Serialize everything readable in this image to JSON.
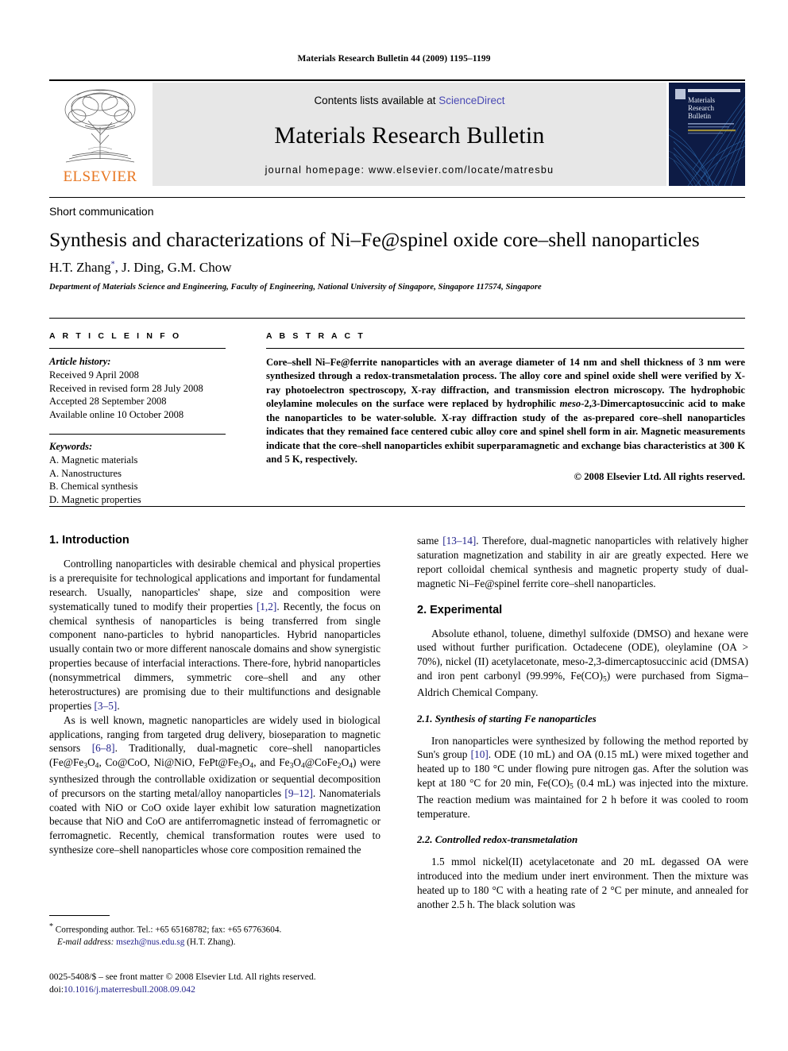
{
  "running_head": "Materials Research Bulletin 44 (2009) 1195–1199",
  "masthead": {
    "publisher": "ELSEVIER",
    "contents_prefix": "Contents lists available at ",
    "sciencedirect": "ScienceDirect",
    "journal_name": "Materials Research Bulletin",
    "homepage": "journal homepage: www.elsevier.com/locate/matresbu",
    "cover_title_line1": "Materials",
    "cover_title_line2": "Research",
    "cover_title_line3": "Bulletin"
  },
  "article": {
    "type": "Short communication",
    "title": "Synthesis and characterizations of Ni–Fe@spinel oxide core–shell nanoparticles",
    "authors": "H.T. Zhang *, J. Ding, G.M. Chow",
    "affiliation": "Department of Materials Science and Engineering, Faculty of Engineering, National University of Singapore, Singapore 117574, Singapore"
  },
  "info": {
    "caption": "A R T I C L E  I N F O",
    "history_label": "Article history:",
    "history": [
      "Received 9 April 2008",
      "Received in revised form 28 July 2008",
      "Accepted 28 September 2008",
      "Available online 10 October 2008"
    ],
    "keywords_label": "Keywords:",
    "keywords": [
      "A. Magnetic materials",
      "A. Nanostructures",
      "B. Chemical synthesis",
      "D. Magnetic properties"
    ]
  },
  "abstract": {
    "caption": "A B S T R A C T",
    "text": "Core–shell Ni–Fe@ferrite nanoparticles with an average diameter of 14 nm and shell thickness of 3 nm were synthesized through a redox-transmetalation process. The alloy core and spinel oxide shell were verified by X-ray photoelectron spectroscopy, X-ray diffraction, and transmission electron microscopy. The hydrophobic oleylamine molecules on the surface were replaced by hydrophilic meso-2,3-Dimercaptosuccinic acid to make the nanoparticles to be water-soluble. X-ray diffraction study of the as-prepared core–shell nanoparticles indicates that they remained face centered cubic alloy core and spinel shell form in air. Magnetic measurements indicate that the core–shell nanoparticles exhibit superparamagnetic and exchange bias characteristics at 300 K and 5 K, respectively.",
    "copyright": "© 2008 Elsevier Ltd. All rights reserved."
  },
  "sections": {
    "introduction_heading": "1. Introduction",
    "intro_p1": "Controlling nanoparticles with desirable chemical and physical properties is a prerequisite for technological applications and important for fundamental research. Usually, nanoparticles' shape, size and composition were systematically tuned to modify their properties [1,2]. Recently, the focus on chemical synthesis of nanoparticles is being transferred from single component nano-particles to hybrid nanoparticles. Hybrid nanoparticles usually contain two or more different nanoscale domains and show synergistic properties because of interfacial interactions. There-fore, hybrid nanoparticles (nonsymmetrical dimmers, symmetric core–shell and any other heterostructures) are promising due to their multifunctions and designable properties [3–5].",
    "intro_p2": "As is well known, magnetic nanoparticles are widely used in biological applications, ranging from targeted drug delivery, bioseparation to magnetic sensors [6–8]. Traditionally, dual-magnetic core–shell nanoparticles (Fe@Fe3O4, Co@CoO, Ni@NiO, FePt@Fe3O4, and Fe3O4@CoFe2O4) were synthesized through the controllable oxidization or sequential decomposition of precursors on the starting metal/alloy nanoparticles [9–12]. Nanomaterials coated with NiO or CoO oxide layer exhibit low saturation magnetization because that NiO and CoO are antiferromagnetic instead of ferromagnetic or ferromagnetic. Recently, chemical transformation routes were used to synthesize core–shell nanoparticles whose core composition remained the",
    "intro_p3": "same [13–14]. Therefore, dual-magnetic nanoparticles with relatively higher saturation magnetization and stability in air are greatly expected. Here we report colloidal chemical synthesis and magnetic property study of dual-magnetic Ni–Fe@spinel ferrite core–shell nanoparticles.",
    "experimental_heading": "2. Experimental",
    "exp_p1": "Absolute ethanol, toluene, dimethyl sulfoxide (DMSO) and hexane were used without further purification. Octadecene (ODE), oleylamine (OA > 70%), nickel (II) acetylacetonate, meso-2,3-dimercaptosuccinic acid (DMSA) and iron pent carbonyl (99.99%, Fe(CO)5) were purchased from Sigma–Aldrich Chemical Company.",
    "sub21_heading": "2.1. Synthesis of starting Fe nanoparticles",
    "sub21_p1": "Iron nanoparticles were synthesized by following the method reported by Sun's group [10]. ODE (10 mL) and OA (0.15 mL) were mixed together and heated up to 180 °C under flowing pure nitrogen gas. After the solution was kept at 180 °C for 20 min, Fe(CO)5 (0.4 mL) was injected into the mixture. The reaction medium was maintained for 2 h before it was cooled to room temperature.",
    "sub22_heading": "2.2. Controlled redox-transmetalation",
    "sub22_p1": "1.5 mmol nickel(II) acetylacetonate and 20 mL degassed OA were introduced into the medium under inert environment. Then the mixture was heated up to 180 °C with a heating rate of 2 °C per minute, and annealed for another 2.5 h. The black solution was"
  },
  "footnote": {
    "corresponding": "* Corresponding author. Tel.: +65 65168782; fax: +65 67763604.",
    "email_label": "E-mail address:",
    "email": "msezh@nus.edu.sg",
    "email_owner": "(H.T. Zhang)."
  },
  "footer": {
    "issn_line": "0025-5408/$ – see front matter © 2008 Elsevier Ltd. All rights reserved.",
    "doi_label": "doi:",
    "doi": "10.1016/j.materresbull.2008.09.042"
  },
  "colors": {
    "link": "#23238c",
    "sciencedirect": "#4a4ab4",
    "elsevier_orange": "#E87722",
    "banner_grey": "#e7e7e7",
    "cover_navy": "#0d1b45"
  }
}
